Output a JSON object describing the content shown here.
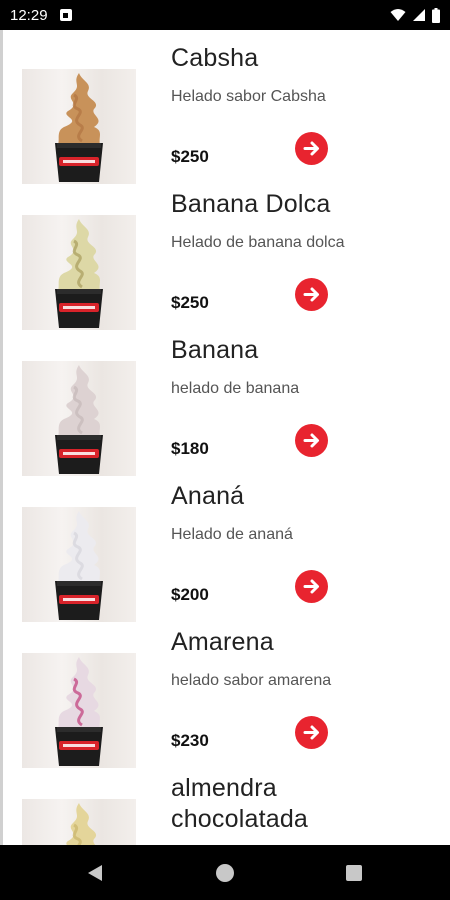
{
  "status_bar": {
    "time": "12:29"
  },
  "products": [
    {
      "name": "Cabsha",
      "description": "Helado sabor Cabsha",
      "price": "$250",
      "swirl_color": "#c8925a",
      "accent_color": "#b07542"
    },
    {
      "name": "Banana Dolca",
      "description": "Helado de banana dolca",
      "price": "$250",
      "swirl_color": "#ddd8a6",
      "accent_color": "#a89c5c"
    },
    {
      "name": "Banana",
      "description": "helado de banana",
      "price": "$180",
      "swirl_color": "#ddd2d2",
      "accent_color": "#c4b8b8"
    },
    {
      "name": "Ananá",
      "description": "Helado de ananá",
      "price": "$200",
      "swirl_color": "#ecebef",
      "accent_color": "#d6d4dc"
    },
    {
      "name": "Amarena",
      "description": "helado sabor amarena",
      "price": "$230",
      "swirl_color": "#e7d9e2",
      "accent_color": "#c03a7a"
    },
    {
      "name": "almendra\nchocolatada",
      "description": "",
      "price": "",
      "swirl_color": "#e4d59a",
      "accent_color": "#c9b46a"
    }
  ],
  "cup": {
    "brand_color": "#d8232a",
    "cup_color": "#1c1c1c"
  },
  "accent_button_color": "#e8242f",
  "icons": {
    "notification": "notification-icon",
    "wifi": "wifi-icon",
    "signal": "signal-icon",
    "battery": "battery-icon",
    "arrow": "arrow-right-circle-icon",
    "back": "back-triangle-icon",
    "home": "home-circle-icon",
    "recents": "recents-square-icon"
  }
}
